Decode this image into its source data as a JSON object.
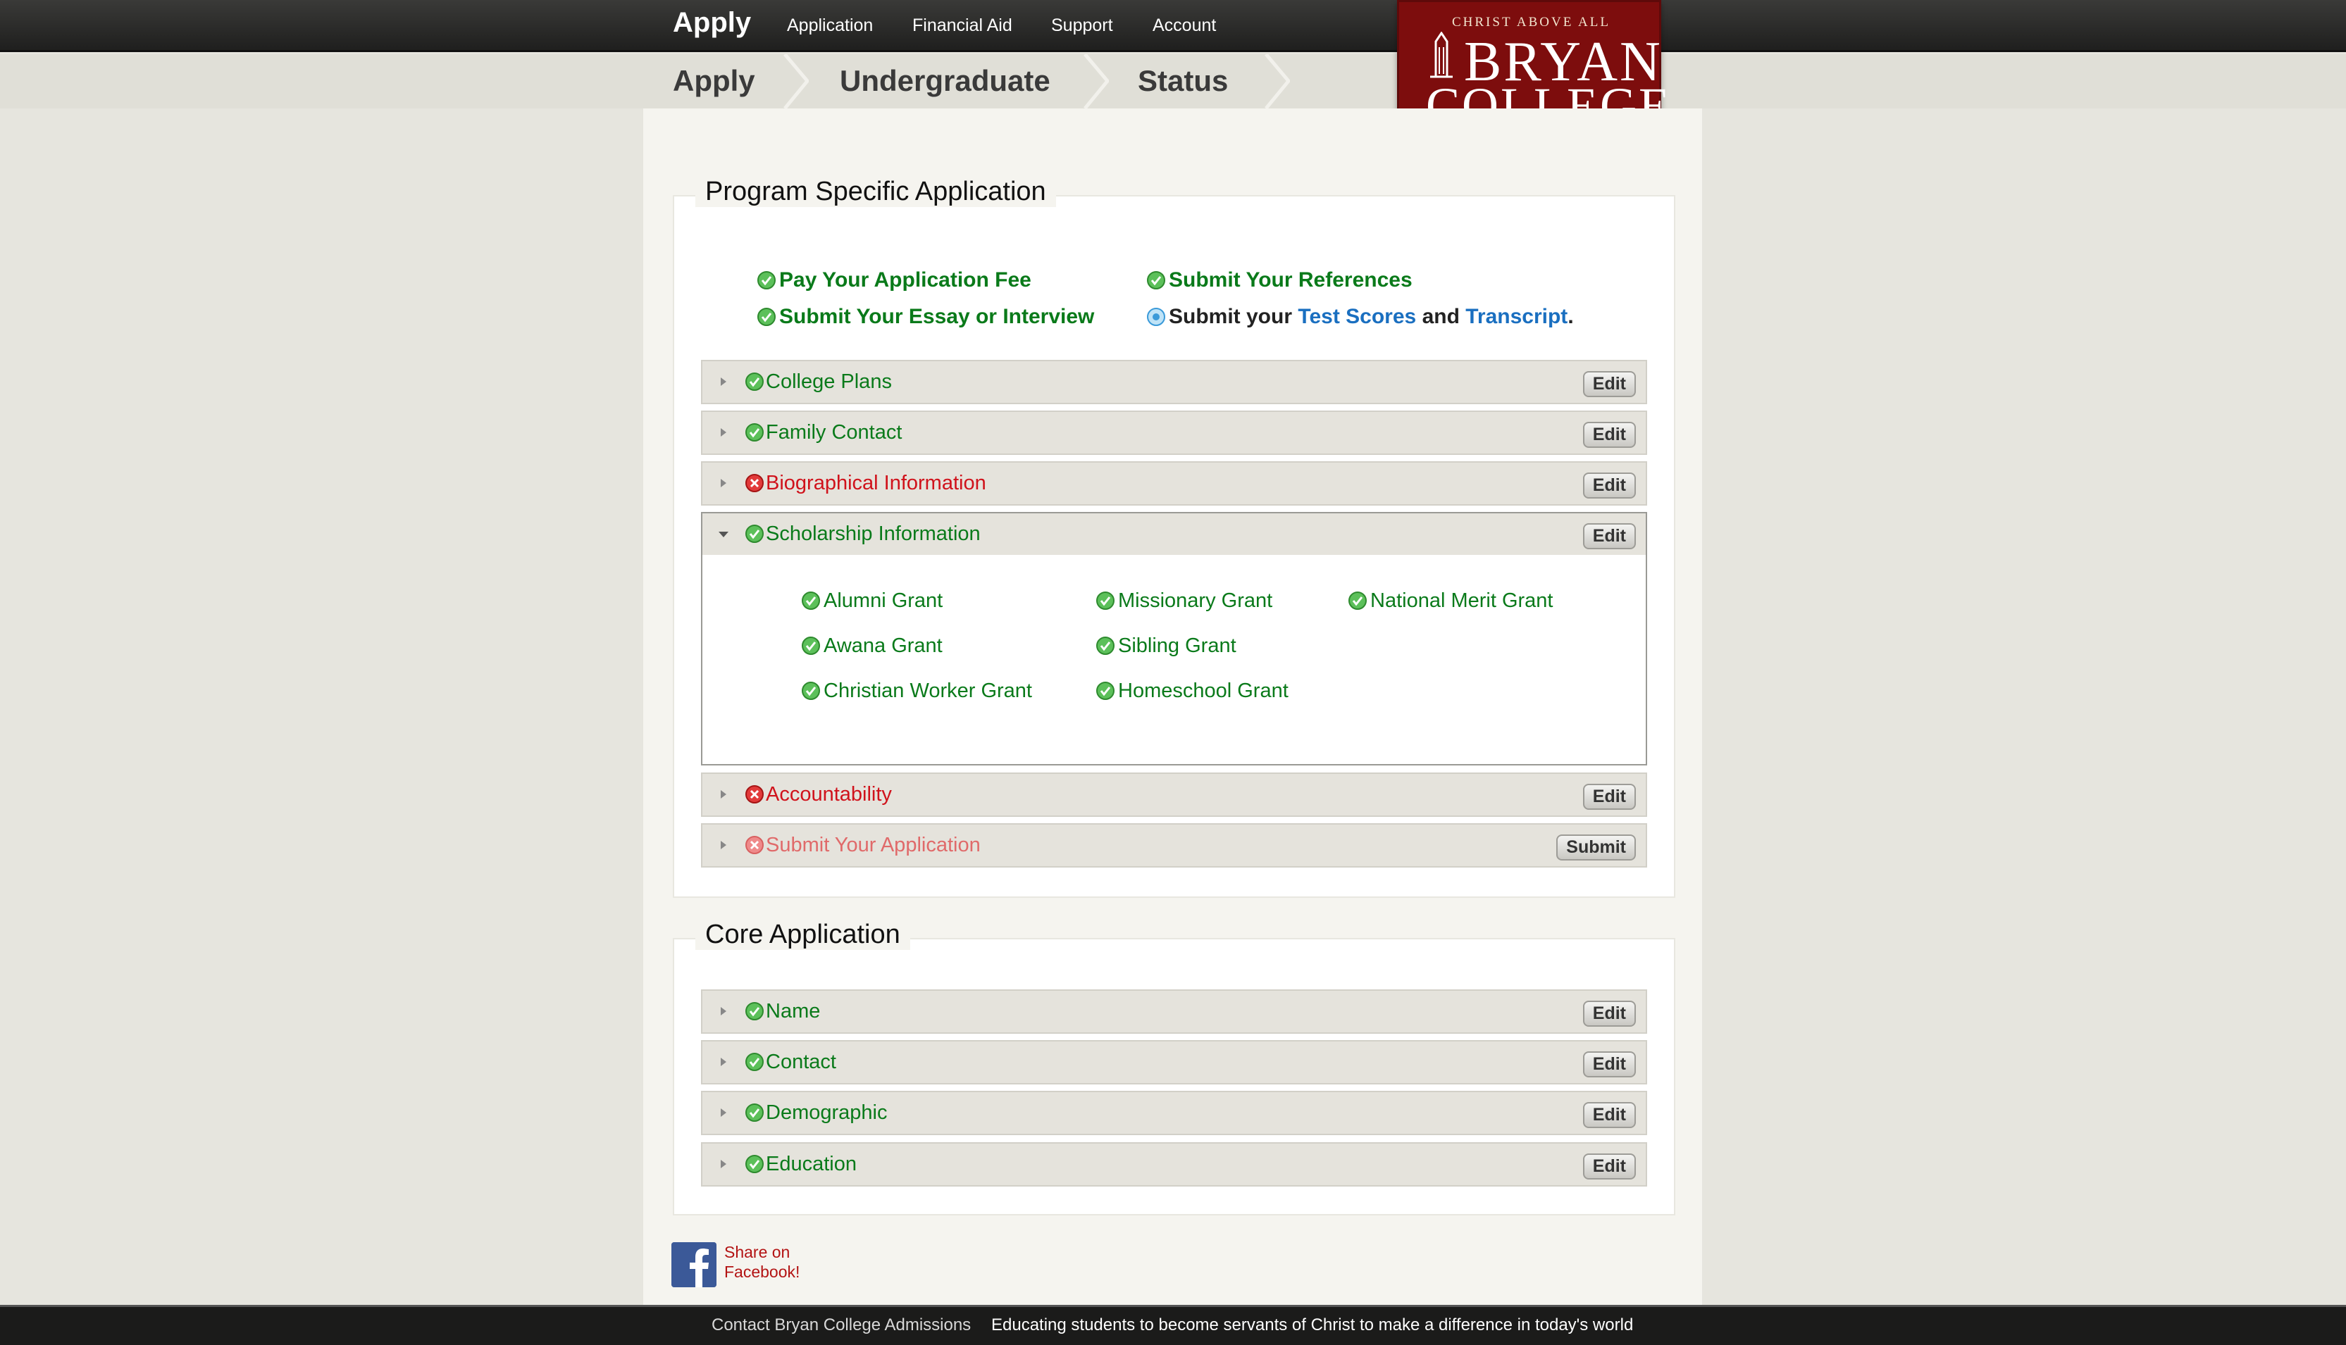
{
  "nav": {
    "brand": "Apply",
    "links": [
      "Application",
      "Financial Aid",
      "Support",
      "Account"
    ]
  },
  "breadcrumb": [
    "Apply",
    "Undergraduate",
    "Status"
  ],
  "logo": {
    "tagline": "CHRIST ABOVE ALL",
    "line1": "BRYAN",
    "line2": "COLLEGE"
  },
  "program": {
    "legend": "Program Specific Application",
    "requirements": {
      "fee": "Pay Your Application Fee",
      "essay": "Submit Your Essay or Interview",
      "references": "Submit Your References",
      "scores_prefix": "Submit your",
      "test_scores": "Test Scores",
      "and": "and",
      "transcript": "Transcript",
      "period": "."
    },
    "sections": [
      {
        "label": "College Plans",
        "button": "Edit",
        "status": "complete"
      },
      {
        "label": "Family Contact",
        "button": "Edit",
        "status": "complete"
      },
      {
        "label": "Biographical Information",
        "button": "Edit",
        "status": "error"
      },
      {
        "label": "Scholarship Information",
        "button": "Edit",
        "status": "complete"
      },
      {
        "label": "Accountability",
        "button": "Edit",
        "status": "error"
      },
      {
        "label": "Submit Your Application",
        "button": "Submit",
        "status": "error"
      }
    ],
    "grants": [
      "Alumni Grant",
      "Awana Grant",
      "Christian Worker Grant",
      "Missionary Grant",
      "Sibling Grant",
      "Homeschool Grant",
      "National Merit Grant"
    ]
  },
  "core": {
    "legend": "Core Application",
    "sections": [
      {
        "label": "Name",
        "button": "Edit",
        "status": "complete"
      },
      {
        "label": "Contact",
        "button": "Edit",
        "status": "complete"
      },
      {
        "label": "Demographic",
        "button": "Edit",
        "status": "complete"
      },
      {
        "label": "Education",
        "button": "Edit",
        "status": "complete"
      }
    ]
  },
  "facebook": {
    "line1": "Share on",
    "line2": "Facebook!"
  },
  "footer": {
    "contact": "Contact Bryan College Admissions",
    "mission": "Educating students to become servants of Christ to make a difference in today's world"
  },
  "colors": {
    "complete": "#0a7a1a",
    "error": "#d0121b",
    "link": "#1a6fc0",
    "brand": "#7d0d0d"
  }
}
